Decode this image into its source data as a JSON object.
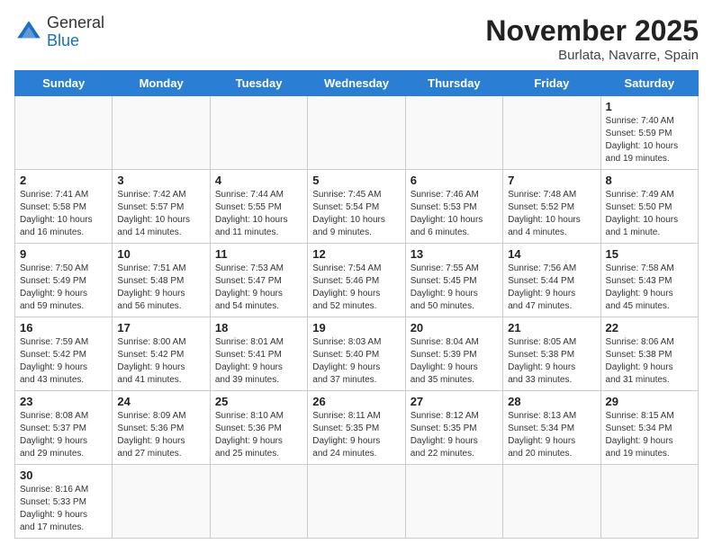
{
  "header": {
    "logo_general": "General",
    "logo_blue": "Blue",
    "month": "November 2025",
    "location": "Burlata, Navarre, Spain"
  },
  "weekdays": [
    "Sunday",
    "Monday",
    "Tuesday",
    "Wednesday",
    "Thursday",
    "Friday",
    "Saturday"
  ],
  "weeks": [
    [
      {
        "day": "",
        "info": ""
      },
      {
        "day": "",
        "info": ""
      },
      {
        "day": "",
        "info": ""
      },
      {
        "day": "",
        "info": ""
      },
      {
        "day": "",
        "info": ""
      },
      {
        "day": "",
        "info": ""
      },
      {
        "day": "1",
        "info": "Sunrise: 7:40 AM\nSunset: 5:59 PM\nDaylight: 10 hours\nand 19 minutes."
      }
    ],
    [
      {
        "day": "2",
        "info": "Sunrise: 7:41 AM\nSunset: 5:58 PM\nDaylight: 10 hours\nand 16 minutes."
      },
      {
        "day": "3",
        "info": "Sunrise: 7:42 AM\nSunset: 5:57 PM\nDaylight: 10 hours\nand 14 minutes."
      },
      {
        "day": "4",
        "info": "Sunrise: 7:44 AM\nSunset: 5:55 PM\nDaylight: 10 hours\nand 11 minutes."
      },
      {
        "day": "5",
        "info": "Sunrise: 7:45 AM\nSunset: 5:54 PM\nDaylight: 10 hours\nand 9 minutes."
      },
      {
        "day": "6",
        "info": "Sunrise: 7:46 AM\nSunset: 5:53 PM\nDaylight: 10 hours\nand 6 minutes."
      },
      {
        "day": "7",
        "info": "Sunrise: 7:48 AM\nSunset: 5:52 PM\nDaylight: 10 hours\nand 4 minutes."
      },
      {
        "day": "8",
        "info": "Sunrise: 7:49 AM\nSunset: 5:50 PM\nDaylight: 10 hours\nand 1 minute."
      }
    ],
    [
      {
        "day": "9",
        "info": "Sunrise: 7:50 AM\nSunset: 5:49 PM\nDaylight: 9 hours\nand 59 minutes."
      },
      {
        "day": "10",
        "info": "Sunrise: 7:51 AM\nSunset: 5:48 PM\nDaylight: 9 hours\nand 56 minutes."
      },
      {
        "day": "11",
        "info": "Sunrise: 7:53 AM\nSunset: 5:47 PM\nDaylight: 9 hours\nand 54 minutes."
      },
      {
        "day": "12",
        "info": "Sunrise: 7:54 AM\nSunset: 5:46 PM\nDaylight: 9 hours\nand 52 minutes."
      },
      {
        "day": "13",
        "info": "Sunrise: 7:55 AM\nSunset: 5:45 PM\nDaylight: 9 hours\nand 50 minutes."
      },
      {
        "day": "14",
        "info": "Sunrise: 7:56 AM\nSunset: 5:44 PM\nDaylight: 9 hours\nand 47 minutes."
      },
      {
        "day": "15",
        "info": "Sunrise: 7:58 AM\nSunset: 5:43 PM\nDaylight: 9 hours\nand 45 minutes."
      }
    ],
    [
      {
        "day": "16",
        "info": "Sunrise: 7:59 AM\nSunset: 5:42 PM\nDaylight: 9 hours\nand 43 minutes."
      },
      {
        "day": "17",
        "info": "Sunrise: 8:00 AM\nSunset: 5:42 PM\nDaylight: 9 hours\nand 41 minutes."
      },
      {
        "day": "18",
        "info": "Sunrise: 8:01 AM\nSunset: 5:41 PM\nDaylight: 9 hours\nand 39 minutes."
      },
      {
        "day": "19",
        "info": "Sunrise: 8:03 AM\nSunset: 5:40 PM\nDaylight: 9 hours\nand 37 minutes."
      },
      {
        "day": "20",
        "info": "Sunrise: 8:04 AM\nSunset: 5:39 PM\nDaylight: 9 hours\nand 35 minutes."
      },
      {
        "day": "21",
        "info": "Sunrise: 8:05 AM\nSunset: 5:38 PM\nDaylight: 9 hours\nand 33 minutes."
      },
      {
        "day": "22",
        "info": "Sunrise: 8:06 AM\nSunset: 5:38 PM\nDaylight: 9 hours\nand 31 minutes."
      }
    ],
    [
      {
        "day": "23",
        "info": "Sunrise: 8:08 AM\nSunset: 5:37 PM\nDaylight: 9 hours\nand 29 minutes."
      },
      {
        "day": "24",
        "info": "Sunrise: 8:09 AM\nSunset: 5:36 PM\nDaylight: 9 hours\nand 27 minutes."
      },
      {
        "day": "25",
        "info": "Sunrise: 8:10 AM\nSunset: 5:36 PM\nDaylight: 9 hours\nand 25 minutes."
      },
      {
        "day": "26",
        "info": "Sunrise: 8:11 AM\nSunset: 5:35 PM\nDaylight: 9 hours\nand 24 minutes."
      },
      {
        "day": "27",
        "info": "Sunrise: 8:12 AM\nSunset: 5:35 PM\nDaylight: 9 hours\nand 22 minutes."
      },
      {
        "day": "28",
        "info": "Sunrise: 8:13 AM\nSunset: 5:34 PM\nDaylight: 9 hours\nand 20 minutes."
      },
      {
        "day": "29",
        "info": "Sunrise: 8:15 AM\nSunset: 5:34 PM\nDaylight: 9 hours\nand 19 minutes."
      }
    ],
    [
      {
        "day": "30",
        "info": "Sunrise: 8:16 AM\nSunset: 5:33 PM\nDaylight: 9 hours\nand 17 minutes."
      },
      {
        "day": "",
        "info": ""
      },
      {
        "day": "",
        "info": ""
      },
      {
        "day": "",
        "info": ""
      },
      {
        "day": "",
        "info": ""
      },
      {
        "day": "",
        "info": ""
      },
      {
        "day": "",
        "info": ""
      }
    ]
  ]
}
